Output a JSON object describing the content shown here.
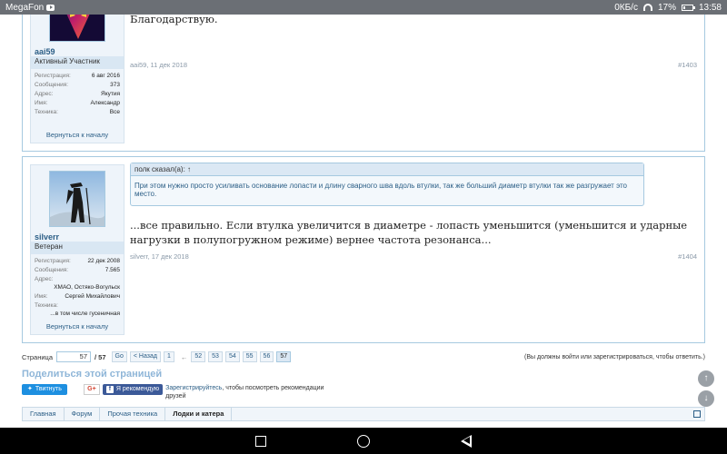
{
  "status_bar": {
    "carrier": "MegaFon",
    "speed": "0КБ/с",
    "battery": "17%",
    "time": "13:58"
  },
  "posts": [
    {
      "username": "aai59",
      "user_title": "Активный Участник",
      "info": [
        {
          "k": "Регистрация:",
          "v": "6 авг 2016"
        },
        {
          "k": "Сообщения:",
          "v": "373"
        },
        {
          "k": "Адрес:",
          "v": "Якутия"
        },
        {
          "k": "Имя:",
          "v": "Александр"
        },
        {
          "k": "Техника:",
          "v": "Все"
        }
      ],
      "back_link": "Вернуться к началу",
      "text": "Благодарствую.",
      "meta_author_date": "aai59, 11 дек 2018",
      "post_num": "#1403"
    },
    {
      "username": "silverr",
      "user_title": "Ветеран",
      "info": [
        {
          "k": "Регистрация:",
          "v": "22 дек 2008"
        },
        {
          "k": "Сообщения:",
          "v": "7.565"
        },
        {
          "k": "Адрес:",
          "v": ""
        },
        {
          "k": "",
          "v": "ХМАО, Остяко-Вогульск"
        },
        {
          "k": "Имя:",
          "v": "Сергей Михайлович"
        },
        {
          "k": "Техника:",
          "v": ""
        },
        {
          "k": "",
          "v": "...в том числе гусеничная"
        }
      ],
      "back_link": "Вернуться к началу",
      "quote_head": "полк сказал(а): ↑",
      "quote_body": "При этом нужно просто усиливать основание лопасти и длину сварного шва вдоль втулки, так же больший диаметр втулки так же разгружает это место.",
      "text": "...все правильно. Если втулка увеличится в диаметре - лопасть уменьшится (уменьшится и ударные нагрузки в полупогружном режиме) вернее частота резонанса...",
      "meta_author_date": "silverr, 17 дек 2018",
      "post_num": "#1404"
    }
  ],
  "pager": {
    "label": "Страница",
    "current": "57",
    "total": "/ 57",
    "go": "Go",
    "prev": "< Назад",
    "first": "1",
    "dots": "←",
    "pages": [
      "52",
      "53",
      "54",
      "55",
      "56",
      "57"
    ],
    "note": "(Вы должны войти или зарегистрироваться, чтобы ответить.)"
  },
  "share": {
    "title": "Поделиться этой страницей",
    "twitter": "Твитнуть",
    "gplus": "G+",
    "fb": "Я рекомендую",
    "fb_link": "Зарегистрируйтесь",
    "fb_rest": ", чтобы посмотреть рекомендации друзей"
  },
  "breadcrumb": [
    "Главная",
    "Форум",
    "Прочая техника",
    "Лодки и катера"
  ],
  "fab": {
    "up": "↑",
    "down": "↓"
  },
  "colors": {
    "accent": "#2b5e86",
    "border": "#a6c9e0",
    "share_title": "#8fb6d8"
  }
}
